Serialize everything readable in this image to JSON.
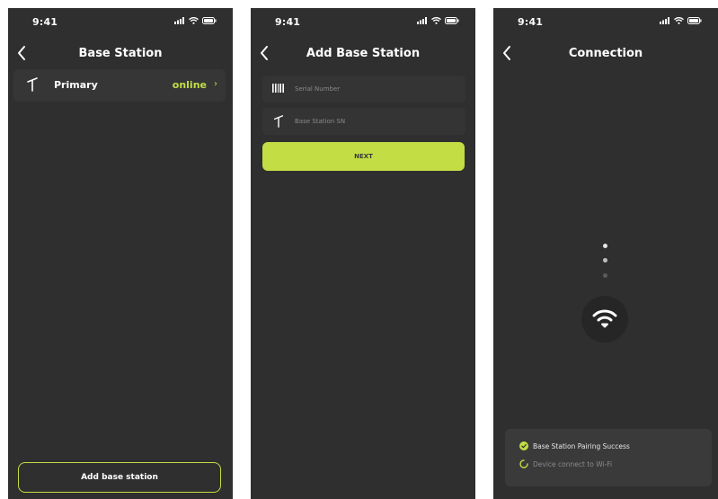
{
  "status_bar": {
    "time": "9:41"
  },
  "colors": {
    "accent": "#c2de44",
    "background": "#2f2f2f",
    "card": "#363636"
  },
  "screen1": {
    "title": "Base Station",
    "stations": [
      {
        "name": "Primary",
        "status": "online",
        "icon": "antenna-icon"
      }
    ],
    "add_button": "Add base station"
  },
  "screen2": {
    "title": "Add Base Station",
    "fields": [
      {
        "placeholder": "Serial Number",
        "value": "",
        "icon": "barcode-icon"
      },
      {
        "placeholder": "Base Station SN",
        "value": "",
        "icon": "antenna-icon"
      }
    ],
    "next_button": "NEXT"
  },
  "screen3": {
    "title": "Connection",
    "center_icon": "wifi-icon",
    "steps": [
      {
        "label": "Base Station Pairing Success",
        "state": "done",
        "icon": "check-circle-icon"
      },
      {
        "label": "Device connect to Wi-Fi",
        "state": "pending",
        "icon": "spinner-icon"
      }
    ]
  }
}
